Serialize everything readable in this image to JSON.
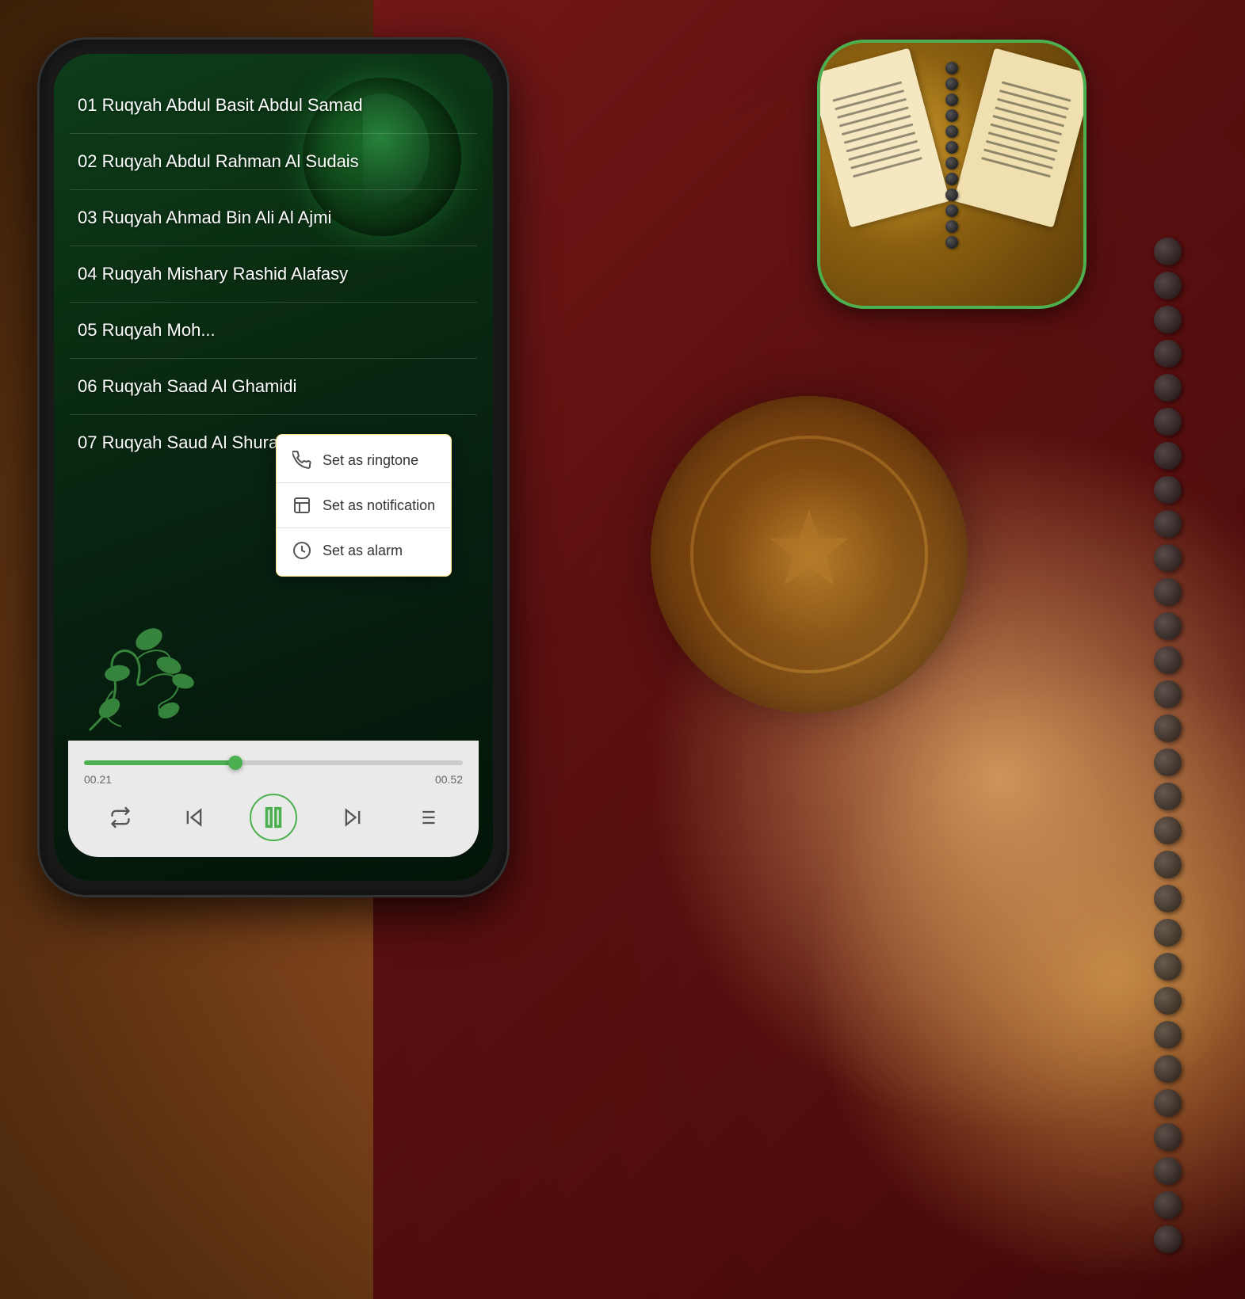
{
  "background": {
    "color": "#5a3a1a"
  },
  "app_icon": {
    "border_color": "#4caf50",
    "alt": "Ruqyah app icon showing Quran pages and rosary beads"
  },
  "phone": {
    "screen_bg": "#0d3d1a"
  },
  "track_list": {
    "items": [
      {
        "id": 1,
        "title": "01 Ruqyah Abdul Basit Abdul Samad"
      },
      {
        "id": 2,
        "title": "02 Ruqyah Abdul Rahman Al Sudais"
      },
      {
        "id": 3,
        "title": "03 Ruqyah Ahmad Bin Ali Al Ajmi"
      },
      {
        "id": 4,
        "title": "04 Ruqyah Mishary Rashid Alafasy"
      },
      {
        "id": 5,
        "title": "05 Ruqyah Moh..."
      },
      {
        "id": 6,
        "title": "06 Ruqyah Saad Al Ghamidi"
      },
      {
        "id": 7,
        "title": "07 Ruqyah Saud Al Shuraim"
      }
    ]
  },
  "context_menu": {
    "items": [
      {
        "id": "ringtone",
        "label": "Set as ringtone",
        "icon": "phone-icon"
      },
      {
        "id": "notification",
        "label": "Set as notification",
        "icon": "notification-icon"
      },
      {
        "id": "alarm",
        "label": "Set as alarm",
        "icon": "alarm-icon"
      }
    ]
  },
  "player": {
    "current_time": "00.21",
    "total_time": "00.52",
    "progress_percent": 40,
    "controls": {
      "repeat_label": "repeat",
      "prev_label": "previous",
      "pause_label": "pause",
      "next_label": "next",
      "playlist_label": "playlist"
    }
  }
}
